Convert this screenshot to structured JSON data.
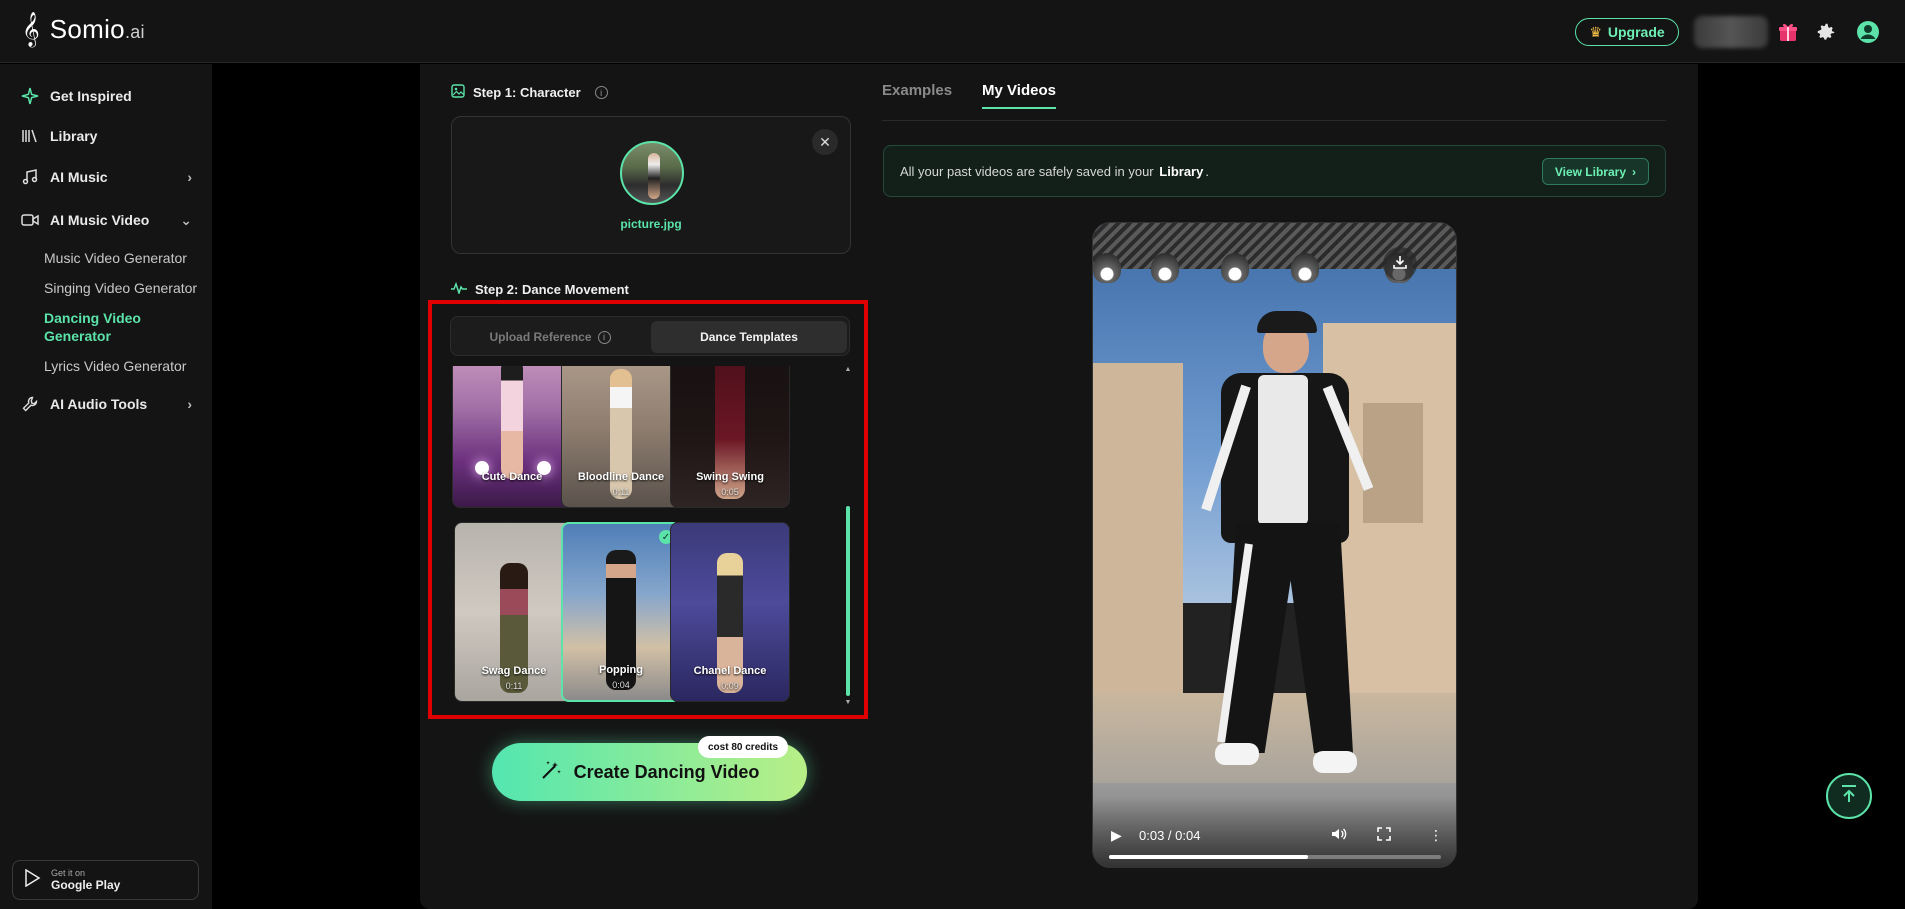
{
  "app": {
    "logo_glyph": "𝄞",
    "name": "Somio",
    "name_suffix": ".ai"
  },
  "header": {
    "upgrade_label": "Upgrade",
    "icons": [
      "gift-icon",
      "gear-icon",
      "user-avatar-icon"
    ]
  },
  "sidebar": {
    "items": [
      {
        "label": "Get Inspired",
        "icon": "sparkle-icon"
      },
      {
        "label": "Library",
        "icon": "library-icon"
      },
      {
        "label": "AI Music",
        "icon": "music-note-icon",
        "expandable": true
      },
      {
        "label": "AI Music Video",
        "icon": "video-camera-icon",
        "expanded": true
      },
      {
        "label": "AI Audio Tools",
        "icon": "wrench-icon",
        "expandable": true
      }
    ],
    "sub_items": [
      {
        "label": "Music Video Generator",
        "active": false
      },
      {
        "label": "Singing Video Generator",
        "active": false
      },
      {
        "label": "Dancing Video Generator",
        "active": true
      },
      {
        "label": "Lyrics Video Generator",
        "active": false
      }
    ],
    "google_play": {
      "small": "Get it on",
      "big": "Google Play"
    },
    "socials": [
      "x-icon",
      "youtube-icon",
      "tiktok-icon",
      "instagram-icon"
    ]
  },
  "step1": {
    "label": "Step 1: Character",
    "file_name": "picture.jpg"
  },
  "step2": {
    "label": "Step 2: Dance Movement",
    "tab_upload": "Upload Reference",
    "tab_templates": "Dance Templates",
    "templates": [
      {
        "name": "Cute Dance",
        "duration": "",
        "selected": false
      },
      {
        "name": "Bloodline Dance",
        "duration": "0:11",
        "selected": false
      },
      {
        "name": "Swing Swing",
        "duration": "0:05",
        "selected": false
      },
      {
        "name": "Swag Dance",
        "duration": "0:11",
        "selected": false
      },
      {
        "name": "Popping",
        "duration": "0:04",
        "selected": true
      },
      {
        "name": "Chanel Dance",
        "duration": "0:09",
        "selected": false
      }
    ]
  },
  "create": {
    "label": "Create Dancing Video",
    "cost": "cost 80 credits"
  },
  "right": {
    "tabs": [
      {
        "label": "Examples",
        "active": false
      },
      {
        "label": "My Videos",
        "active": true
      }
    ],
    "notice_pre": "All your past videos are safely saved in your",
    "notice_bold": "Library",
    "notice_post": ".",
    "view_library": "View Library",
    "video": {
      "timecode": "0:03 / 0:04",
      "progress": 0.6
    }
  }
}
